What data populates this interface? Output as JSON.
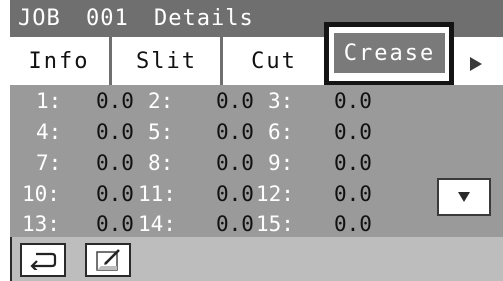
{
  "title": {
    "job": "JOB",
    "number": "001",
    "label": "Details"
  },
  "tabs": [
    {
      "label": "Info"
    },
    {
      "label": "Slit"
    },
    {
      "label": "Cut"
    },
    {
      "label": "Crease"
    }
  ],
  "icons": {
    "next": "right-triangle-icon",
    "scroll_down": "down-triangle-icon",
    "back": "return-arrow-icon",
    "edit": "edit-pad-icon"
  },
  "colors": {
    "header": "#6f6f6f",
    "active_tab": "#7a7a7a",
    "grid": "#9a9a9a",
    "footer": "#bdbdbd"
  },
  "grid": {
    "rows": [
      [
        {
          "label": "1:",
          "value": "0.0"
        },
        {
          "label": "2:",
          "value": "0.0"
        },
        {
          "label": "3:",
          "value": "0.0"
        }
      ],
      [
        {
          "label": "4:",
          "value": "0.0"
        },
        {
          "label": "5:",
          "value": "0.0"
        },
        {
          "label": "6:",
          "value": "0.0"
        }
      ],
      [
        {
          "label": "7:",
          "value": "0.0"
        },
        {
          "label": "8:",
          "value": "0.0"
        },
        {
          "label": "9:",
          "value": "0.0"
        }
      ],
      [
        {
          "label": "10:",
          "value": "0.0"
        },
        {
          "label": "11:",
          "value": "0.0"
        },
        {
          "label": "12:",
          "value": "0.0"
        }
      ],
      [
        {
          "label": "13:",
          "value": "0.0"
        },
        {
          "label": "14:",
          "value": "0.0"
        },
        {
          "label": "15:",
          "value": "0.0"
        }
      ]
    ]
  }
}
